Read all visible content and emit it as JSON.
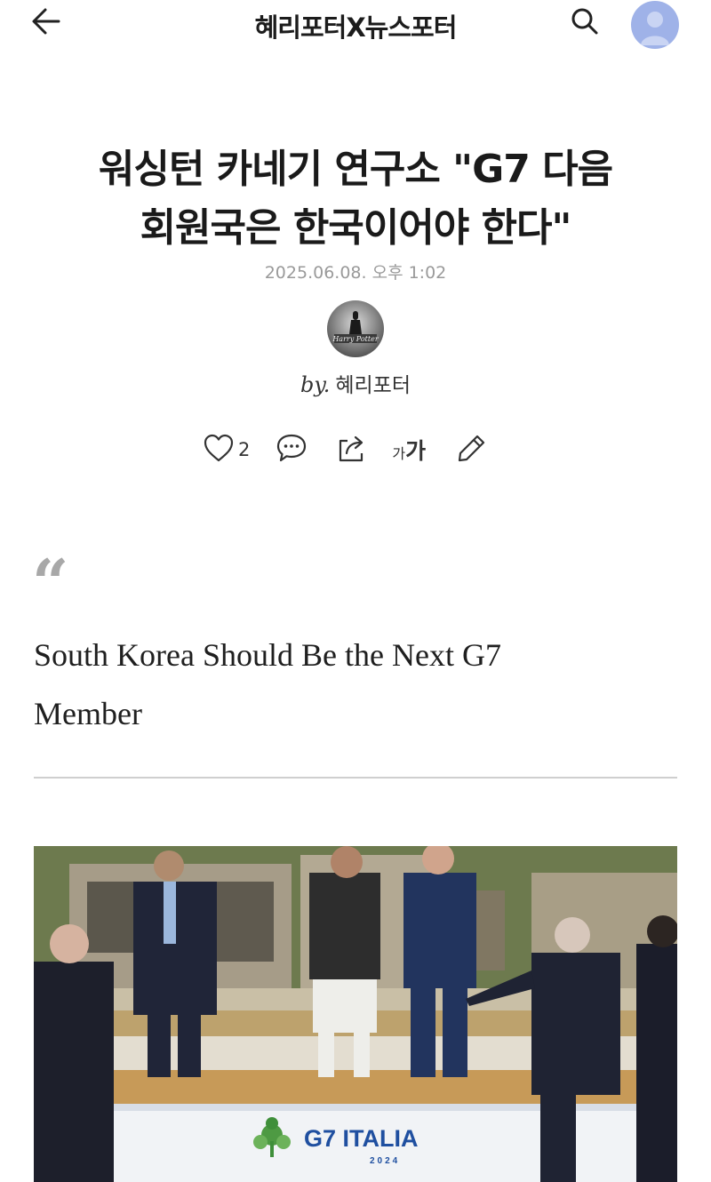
{
  "header": {
    "blog_title": "혜리포터X뉴스포터",
    "back_icon": "arrow-left-icon",
    "search_icon": "search-icon",
    "profile_icon": "user-avatar-icon"
  },
  "article": {
    "title_line1": "워싱턴 카네기 연구소 \"G7 다음",
    "title_line2": "회원국은 한국이어야 한다\"",
    "date": "2025.06.08. 오후 1:02",
    "author_prefix": "by.",
    "author_name": "혜리포터",
    "author_avatar_text": "Harry Potter"
  },
  "actions": {
    "like_count": "2",
    "font_small": "가",
    "font_large": "가",
    "icons": [
      "heart-icon",
      "comment-icon",
      "share-icon",
      "font-size-icon",
      "edit-icon"
    ]
  },
  "quote": {
    "mark": "“",
    "text_line1": "South Korea Should Be the Next G7",
    "text_line2": "Member"
  },
  "photo": {
    "banner_text": "G7 ITALIA",
    "banner_year": "2024"
  },
  "colors": {
    "accent_avatar": "#9fb2e8",
    "date_gray": "#9a9a9a",
    "quote_gray": "#a8a8a8",
    "banner_blue": "#1f4fa0",
    "banner_green": "#3f8f3a"
  }
}
